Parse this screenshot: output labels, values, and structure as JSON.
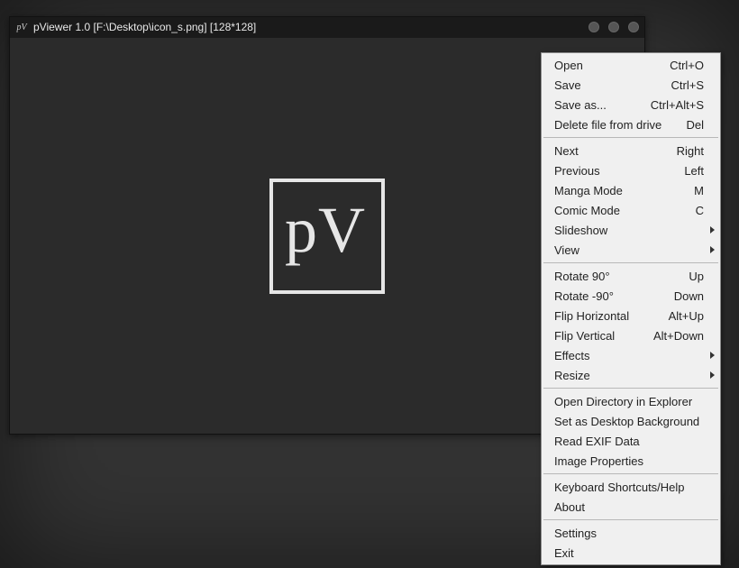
{
  "window": {
    "title": "pViewer 1.0 [F:\\Desktop\\icon_s.png] [128*128]",
    "app_icon": "pV"
  },
  "image": {
    "logo_text": "pV"
  },
  "menu": {
    "groups": [
      [
        {
          "id": "open",
          "label": "Open",
          "accel": "Ctrl+O"
        },
        {
          "id": "save",
          "label": "Save",
          "accel": "Ctrl+S"
        },
        {
          "id": "save-as",
          "label": "Save as...",
          "accel": "Ctrl+Alt+S"
        },
        {
          "id": "delete-file",
          "label": "Delete file from drive",
          "accel": "Del"
        }
      ],
      [
        {
          "id": "next",
          "label": "Next",
          "accel": "Right"
        },
        {
          "id": "previous",
          "label": "Previous",
          "accel": "Left"
        },
        {
          "id": "manga-mode",
          "label": "Manga Mode",
          "accel": "M"
        },
        {
          "id": "comic-mode",
          "label": "Comic Mode",
          "accel": "C"
        },
        {
          "id": "slideshow",
          "label": "Slideshow",
          "submenu": true
        },
        {
          "id": "view",
          "label": "View",
          "submenu": true
        }
      ],
      [
        {
          "id": "rotate-90",
          "label": "Rotate 90°",
          "accel": "Up"
        },
        {
          "id": "rotate-neg-90",
          "label": "Rotate -90°",
          "accel": "Down"
        },
        {
          "id": "flip-horizontal",
          "label": "Flip Horizontal",
          "accel": "Alt+Up"
        },
        {
          "id": "flip-vertical",
          "label": "Flip Vertical",
          "accel": "Alt+Down"
        },
        {
          "id": "effects",
          "label": "Effects",
          "submenu": true
        },
        {
          "id": "resize",
          "label": "Resize",
          "submenu": true
        }
      ],
      [
        {
          "id": "open-directory",
          "label": "Open Directory in Explorer"
        },
        {
          "id": "set-desktop-bg",
          "label": "Set as Desktop Background"
        },
        {
          "id": "read-exif",
          "label": "Read EXIF Data"
        },
        {
          "id": "image-properties",
          "label": "Image Properties"
        }
      ],
      [
        {
          "id": "keyboard-help",
          "label": "Keyboard Shortcuts/Help"
        },
        {
          "id": "about",
          "label": "About"
        }
      ],
      [
        {
          "id": "settings",
          "label": "Settings"
        },
        {
          "id": "exit",
          "label": "Exit"
        }
      ]
    ]
  }
}
